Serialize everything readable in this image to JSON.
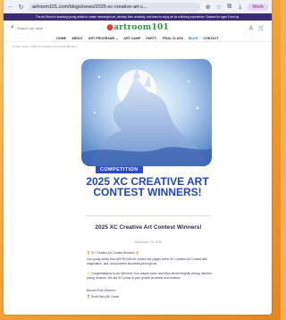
{
  "browser": {
    "url": "artroom101.com/blogs/news/2025-xc-creative-art-c...",
    "profile_label": "Work"
  },
  "announcement": "The Art Room is teaching young artists to create meaningful art, develop their creativity, and learn to enjoy art as a lifelong experience. Classes for ages 5 and up.",
  "header": {
    "search_placeholder": "Search our store",
    "logo_text": "artroom101"
  },
  "nav": {
    "items": [
      "HOME",
      "ABOUT",
      "ART PROGRAMS ⌄",
      "ART CAMP",
      "PARTY",
      "TRIAL CLASS",
      "BLOG",
      "CONTACT"
    ],
    "active_index": 6
  },
  "breadcrumb": "Home / News / 2025 XC Creative Art Contest Winners!",
  "hero": {
    "tag": "COMPETITION",
    "title": "2025 XC CREATIVE ART CONTEST WINNERS!"
  },
  "article": {
    "title": "2025 XC Creative Art Contest Winners!",
    "date": "November 18, 2025",
    "p1": "🏆 XC Creative Art Contest Winners! 🏆",
    "p2": "Our young artists from ARTROOM101 wowed the judges at the XC Creative Art Contest with imagination, skill, and powerful storytelling through art.",
    "p3": "✨ Congratulations to our Winners! Your unique vision and effort shined brightly among talented young creators. We are SO proud of your growth as artists and creators.",
    "p4": "Bronze Prize Winners:",
    "p5": "🏅 Scott Ren (4th Grade"
  }
}
